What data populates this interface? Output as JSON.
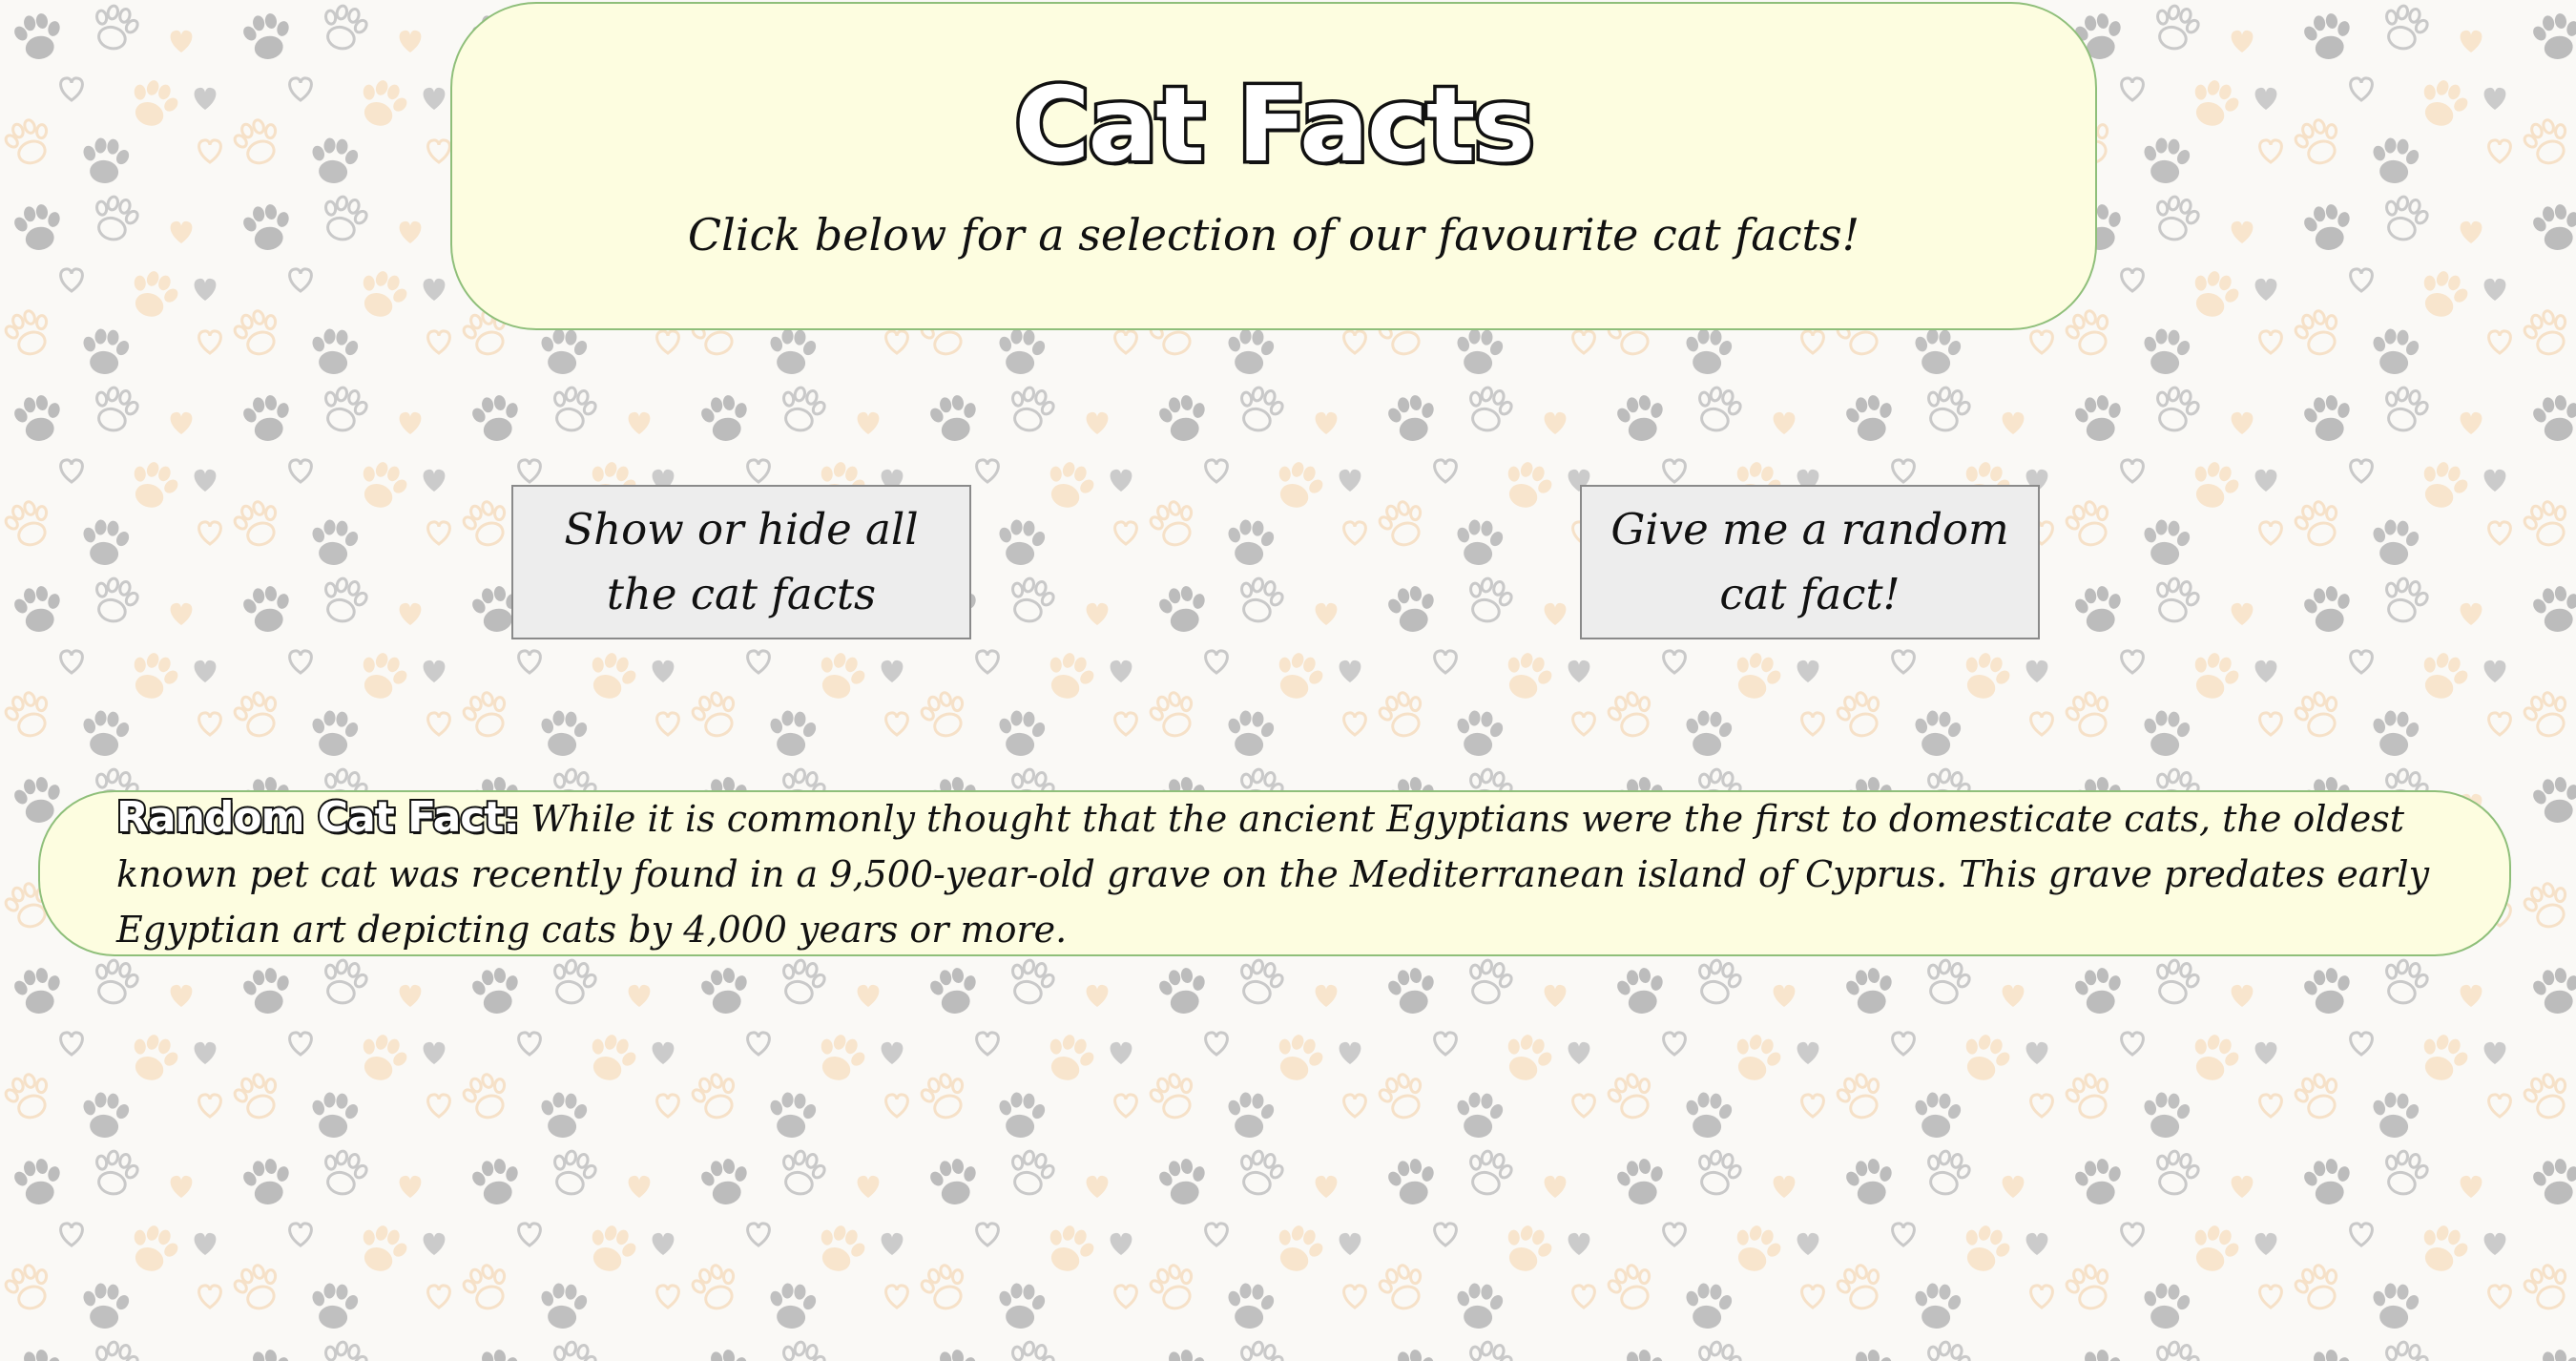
{
  "header": {
    "title": "Cat Facts",
    "subtitle": "Click below for a selection of our favourite cat facts!"
  },
  "buttons": {
    "toggle_label": "Show or hide all the cat facts",
    "random_label": "Give me a random cat fact!"
  },
  "random_fact": {
    "label": "Random Cat Fact:",
    "text": " While it is commonly thought that the ancient Egyptians were the first to domesticate cats, the oldest known pet cat was recently found in a 9,500-year-old grave on the Mediterranean island of Cyprus. This grave predates early Egyptian art depicting cats by 4,000 years or more."
  },
  "colors": {
    "card_background": "#fdfde0",
    "card_border": "#8fbf7a",
    "button_background": "#ededed",
    "paw_grey": "#a3a3a3",
    "paw_peach": "#f6dcba"
  },
  "icons": {
    "background_pattern": "paw-print-and-heart-pattern"
  }
}
